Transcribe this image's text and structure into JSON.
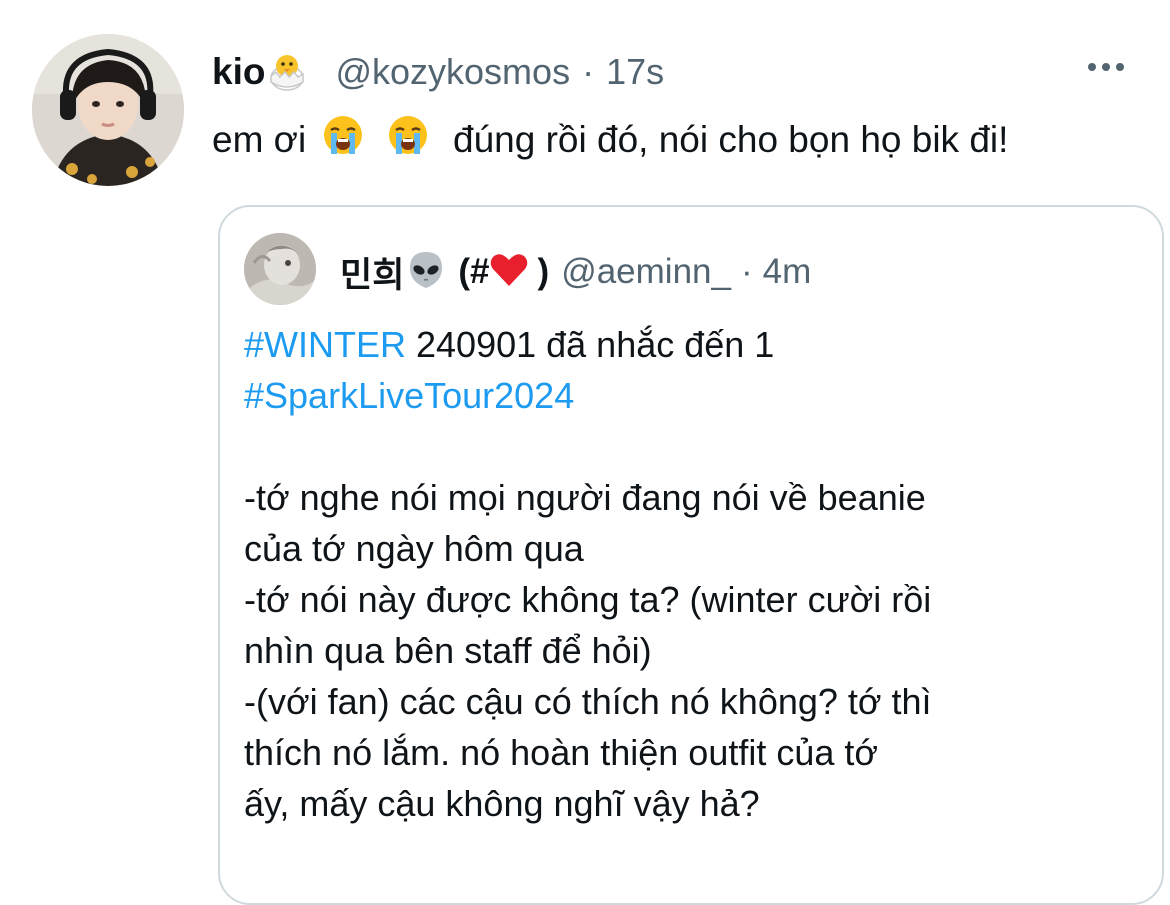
{
  "tweet": {
    "display_name": "kio",
    "name_emoji": "hatching-chick",
    "handle": "@kozykosmos",
    "separator": "·",
    "time": "17s",
    "body": {
      "text_before": "em ơi",
      "emojis": [
        "loudly-crying-face",
        "loudly-crying-face"
      ],
      "text_after": "đúng rồi đó, nói cho bọn họ bik đi!"
    }
  },
  "quote": {
    "display_name": "민희",
    "name_emoji": "alien",
    "name_suffix_open": "(#",
    "name_suffix_emoji": "red-heart",
    "name_suffix_close": ")",
    "handle": "@aeminn_",
    "separator": "·",
    "time": "4m",
    "lines": [
      {
        "hashtag": "#WINTER",
        "text": " 240901 đã nhắc đến 1"
      },
      {
        "hashtag": "#SparkLiveTour2024",
        "text": ""
      },
      {
        "hashtag": "",
        "text": ""
      },
      {
        "hashtag": "",
        "text": "-tớ nghe nói mọi người đang nói về beanie"
      },
      {
        "hashtag": "",
        "text": "của tớ ngày hôm qua"
      },
      {
        "hashtag": "",
        "text": "-tớ nói này được không ta? (winter cười rồi"
      },
      {
        "hashtag": "",
        "text": "nhìn qua bên staff để hỏi)"
      },
      {
        "hashtag": "",
        "text": "-(với fan) các cậu có thích nó không? tớ thì"
      },
      {
        "hashtag": "",
        "text": "thích nó lắm. nó hoàn thiện outfit của tớ"
      },
      {
        "hashtag": "",
        "text": "ấy, mấy cậu không nghĩ vậy hả?"
      }
    ]
  },
  "colors": {
    "text": "#0f1419",
    "secondary": "#536471",
    "link": "#1d9bf0",
    "border": "#cfd9de"
  }
}
